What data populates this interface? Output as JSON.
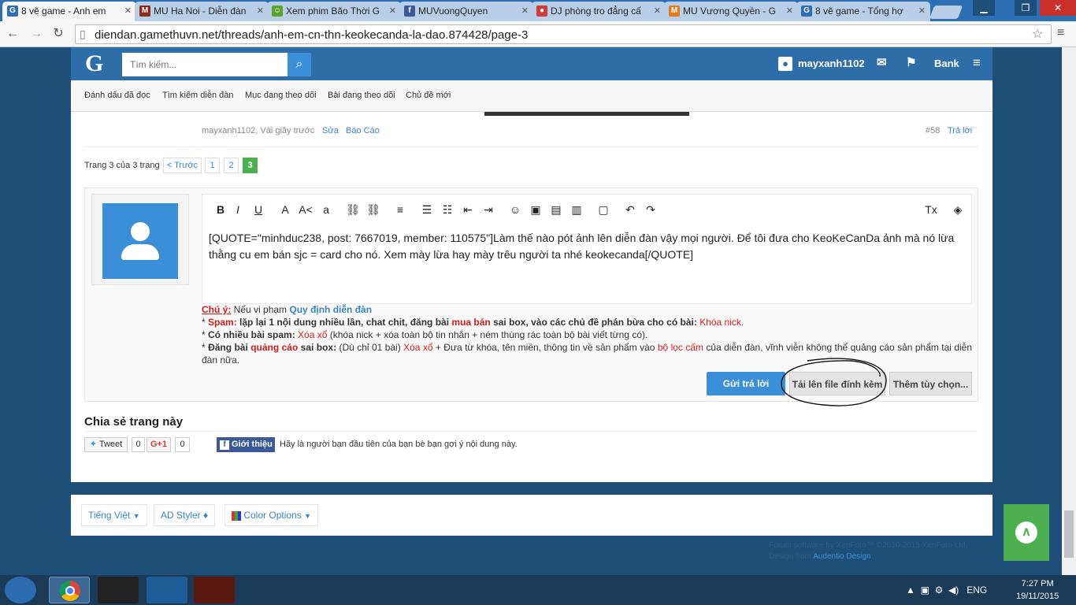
{
  "browser": {
    "tabs": [
      {
        "title": "8 vẽ game - Anh em",
        "active": true,
        "fav": "G",
        "color": "#2d6fb4"
      },
      {
        "title": "MU Ha Noi - Diễn đàn",
        "active": false,
        "fav": "M",
        "color": "#8b2c1b"
      },
      {
        "title": "Xem phim Bão Thời G",
        "active": false,
        "fav": "☺",
        "color": "#5aa52b"
      },
      {
        "title": "MUVuongQuyen",
        "active": false,
        "fav": "f",
        "color": "#3b5998"
      },
      {
        "title": "DJ phòng tro đẳng cấ",
        "active": false,
        "fav": "●",
        "color": "#d13b3b"
      },
      {
        "title": "MU Vương Quyền - G",
        "active": false,
        "fav": "M",
        "color": "#e07b1a"
      },
      {
        "title": "8 vẽ game - Tổng hợ",
        "active": false,
        "fav": "G",
        "color": "#2d6fb4"
      }
    ],
    "url": "diendan.gamethuvn.net/threads/anh-em-cn-thn-keokecanda-la-dao.874428/page-3"
  },
  "header": {
    "logo": "G",
    "search_placeholder": "Tìm kiếm...",
    "username": "mayxanh1102",
    "bank": "Bank"
  },
  "subnav": [
    "Đánh dấu đã đọc",
    "Tìm kiếm diễn đàn",
    "Mục đang theo dõi",
    "Bài đang theo dõi",
    "Chủ đề mới"
  ],
  "post_meta": {
    "author": "mayxanh1102, Vài giây trước",
    "edit": "Sửa",
    "report": "Báo Cáo",
    "number": "#58",
    "reply": "Trả lời"
  },
  "pager": {
    "label": "Trang 3 của 3 trang",
    "prev": "< Trước",
    "pages": [
      "1",
      "2",
      "3"
    ],
    "current": "3"
  },
  "editor": {
    "content": "[QUOTE=\"minhduc238, post: 7667019, member: 110575\"]Làm thế nào pót ảnh lên diễn đàn vậy mọi người. Để tôi đưa cho KeoKeCanDa ảnh mà nó lừa thằng cu em bán sjc = card cho nó. Xem mày lừa hay mày trêu người ta nhé keokecanda[/QUOTE]"
  },
  "rules": {
    "l1_a": "Chú ý:",
    "l1_b": " Nếu vi phạm ",
    "l1_c": "Quy định diễn đàn",
    "l2_a": "* ",
    "l2_b": "Spam:",
    "l2_c": " lặp lại 1 nội dung nhiều lần, chat chit, đăng bài ",
    "l2_d": "mua bán",
    "l2_e": " sai box, vào các chủ đề phán bừa cho có bài: ",
    "l2_f": "Khóa nick.",
    "l3_a": "* ",
    "l3_b": "Có nhiều bài spam:",
    "l3_c": " Xóa xổ",
    "l3_d": " (khóa nick + xóa toàn bộ tin nhắn + ném thùng rác toàn bộ bài viết từng có).",
    "l4_a": "* ",
    "l4_b": "Đăng bài ",
    "l4_c": "quảng cáo",
    "l4_d": " sai box:",
    "l4_e": " (Dù chỉ 01 bài) ",
    "l4_f": "Xóa xổ",
    "l4_g": " + Đưa từ khóa, tên miền, thông tin về sản phẩm vào ",
    "l4_h": "bộ lọc cấm",
    "l4_i": " của diễn đàn, vĩnh viễn không thể quảng cáo sản phẩm tại diễn đàn nữa."
  },
  "buttons": {
    "submit": "Gửi trả lời",
    "upload": "Tải lên file đính kèm",
    "more": "Thêm tùy chọn..."
  },
  "share": {
    "title": "Chia sẻ trang này",
    "tweet": "Tweet",
    "tweet_count": "0",
    "gplus": "G+1",
    "gplus_count": "0",
    "fb": "Giới thiệu",
    "fb_text": "Hãy là người bạn đầu tiên của bạn bè bạn gợi ý nội dung này."
  },
  "footer": {
    "lang": "Tiếng Việt",
    "styler": "AD Styler",
    "color": "Color Options",
    "copy1": "Forum software by XenForo™ ©2010-2015 XenForo Ltd.",
    "copy2a": "Design from ",
    "copy2b": "Audentio Design"
  },
  "taskbar": {
    "lang": "ENG",
    "time": "7:27 PM",
    "date": "19/11/2015"
  }
}
